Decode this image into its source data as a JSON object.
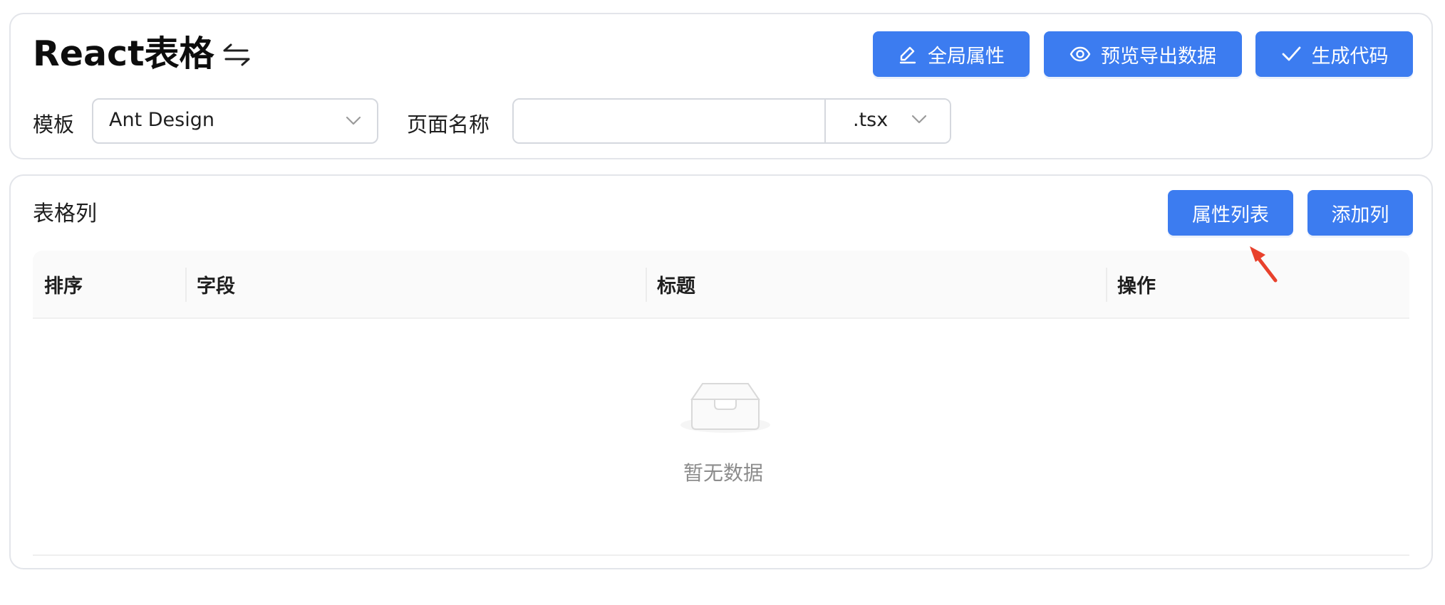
{
  "header": {
    "title": "React表格"
  },
  "toolbar": {
    "global_props_label": "全局属性",
    "preview_export_label": "预览导出数据",
    "generate_code_label": "生成代码"
  },
  "form": {
    "template_label": "模板",
    "template_value": "Ant Design",
    "page_name_label": "页面名称",
    "page_name_value": "",
    "extension_value": ".tsx"
  },
  "columns_section": {
    "title": "表格列",
    "attr_list_label": "属性列表",
    "add_column_label": "添加列",
    "headers": [
      "排序",
      "字段",
      "标题",
      "操作"
    ],
    "rows": [],
    "empty_text": "暂无数据"
  },
  "colors": {
    "primary": "#3c7cf0",
    "annotation_arrow": "#e8412c"
  },
  "icons": [
    "swap-arrows-icon",
    "edit-icon",
    "eye-icon",
    "check-icon",
    "chevron-down-icon",
    "empty-inbox-icon"
  ]
}
